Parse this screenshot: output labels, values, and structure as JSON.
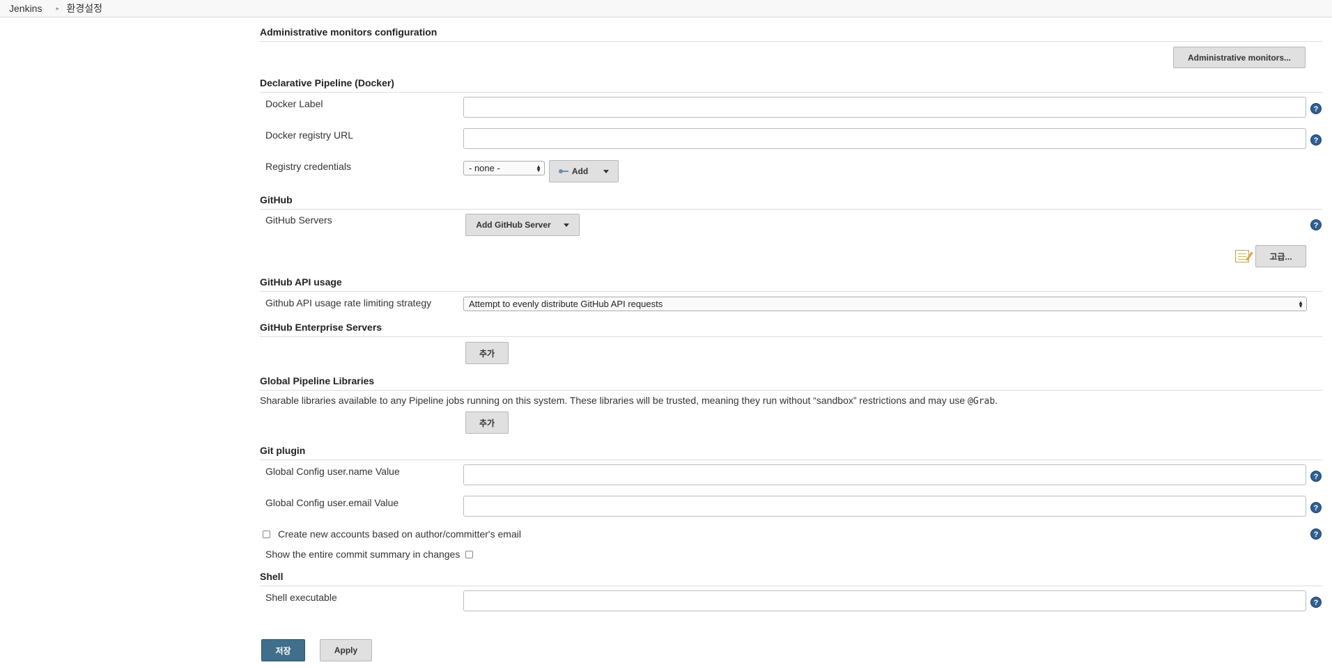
{
  "breadcrumb": {
    "root": "Jenkins",
    "separator": "▸",
    "current": "환경설정"
  },
  "sections": {
    "admin_monitors": {
      "title": "Administrative monitors configuration",
      "button": "Administrative monitors..."
    },
    "docker": {
      "title": "Declarative Pipeline (Docker)",
      "docker_label": "Docker Label",
      "registry_url": "Docker registry URL",
      "registry_credentials": "Registry credentials",
      "credentials_value": "- none -",
      "add_button": "Add"
    },
    "github": {
      "title": "GitHub",
      "servers_label": "GitHub Servers",
      "add_server_button": "Add GitHub Server",
      "advanced_button": "고급..."
    },
    "github_api": {
      "title": "GitHub API usage",
      "strategy_label": "Github API usage rate limiting strategy",
      "strategy_value": "Attempt to evenly distribute GitHub API requests"
    },
    "github_enterprise": {
      "title": "GitHub Enterprise Servers",
      "add_button": "추가"
    },
    "global_libraries": {
      "title": "Global Pipeline Libraries",
      "description_prefix": "Sharable libraries available to any Pipeline jobs running on this system. These libraries will be trusted, meaning they run without “sandbox” restrictions and may use ",
      "description_code": "@Grab",
      "description_suffix": ".",
      "add_button": "추가"
    },
    "git_plugin": {
      "title": "Git plugin",
      "user_name_label": "Global Config user.name Value",
      "user_email_label": "Global Config user.email Value",
      "create_accounts_label": "Create new accounts based on author/committer's email",
      "commit_summary_label": "Show the entire commit summary in changes"
    },
    "shell": {
      "title": "Shell",
      "executable_label": "Shell executable"
    }
  },
  "footer": {
    "save_button": "저장",
    "apply_button": "Apply"
  },
  "help_icon_glyph": "?",
  "colors": {
    "save_button_bg": "#3f6f8a",
    "help_icon_bg": "#2f5f93"
  }
}
